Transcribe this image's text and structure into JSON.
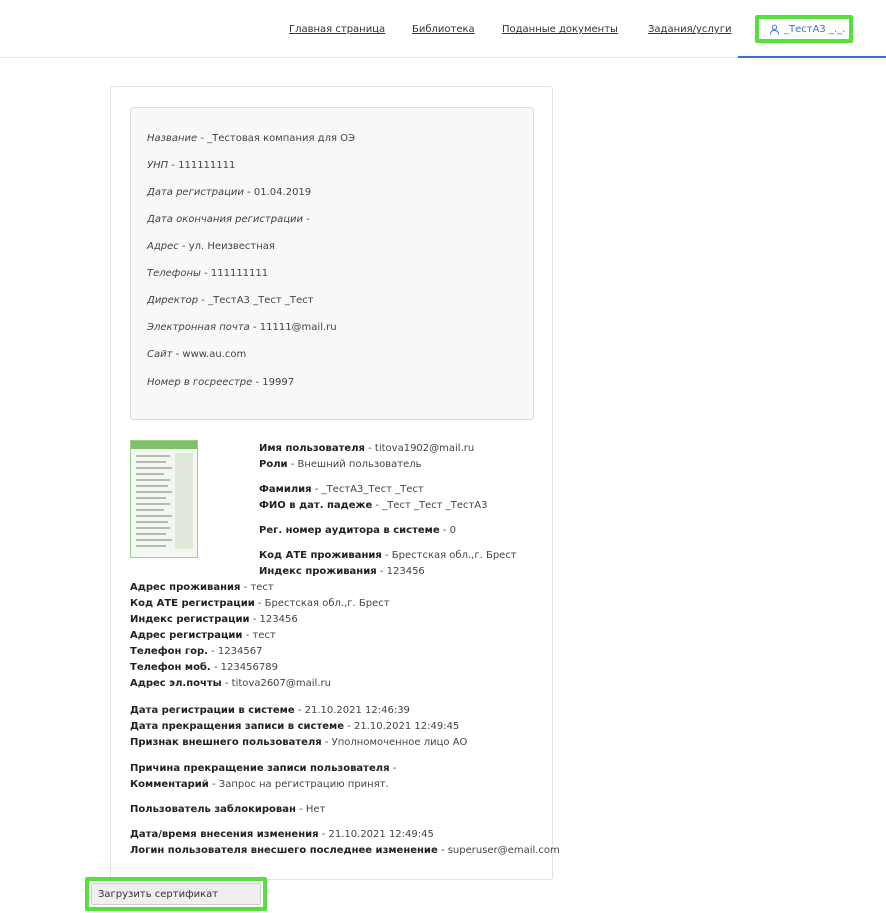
{
  "nav": {
    "items": [
      "Главная страница",
      "Библиотека",
      "Поданные документы",
      "Задания/услуги"
    ],
    "user": "_ТестА3 _._."
  },
  "company": [
    {
      "k": "Название",
      "v": " - _Тестовая компания для ОЭ"
    },
    {
      "k": "УНП",
      "v": " - 111111111"
    },
    {
      "k": "Дата регистрации",
      "v": " - 01.04.2019"
    },
    {
      "k": "Дата окончания регистрации",
      "v": " -"
    },
    {
      "k": "Адрес",
      "v": " - ул. Неизвестная"
    },
    {
      "k": "Телефоны",
      "v": " - 111111111"
    },
    {
      "k": "Директор",
      "v": " - _ТестА3 _Тест _Тест"
    },
    {
      "k": "Электронная почта",
      "v": " - 11111@mail.ru"
    },
    {
      "k": "Сайт",
      "v": " - www.au.com"
    },
    {
      "k": "Номер в госреестре",
      "v": " - 19997"
    }
  ],
  "user": [
    {
      "k": "Имя пользователя",
      "v": " - titova1902@mail.ru"
    },
    {
      "k": "Роли",
      "v": " - Внешний пользователь"
    },
    {
      "k": "Фамилия",
      "v": " - _ТестА3_Тест _Тест"
    },
    {
      "k": "ФИО в дат. падеже",
      "v": " - _Тест _Тест _ТестА3"
    },
    {
      "k": "Рег. номер аудитора в системе",
      "v": " - 0"
    },
    {
      "k": "Код АТЕ проживания",
      "v": " - Брестская обл.,г. Брест"
    },
    {
      "k": "Индекс проживания",
      "v": " - 123456"
    },
    {
      "k": "Адрес проживания",
      "v": " - тест"
    },
    {
      "k": "Код АТЕ регистрации",
      "v": " - Брестская обл.,г. Брест"
    },
    {
      "k": "Индекс регистрации",
      "v": " - 123456"
    },
    {
      "k": "Адрес регистрации",
      "v": " - тест"
    },
    {
      "k": "Телефон гор.",
      "v": " - 1234567"
    },
    {
      "k": "Телефон моб.",
      "v": " - 123456789"
    },
    {
      "k": "Адрес эл.почты",
      "v": " - titova2607@mail.ru"
    },
    {
      "k": "Дата регистрации в системе",
      "v": " - 21.10.2021 12:46:39"
    },
    {
      "k": "Дата прекращения записи в системе",
      "v": " - 21.10.2021 12:49:45"
    },
    {
      "k": "Признак внешнего пользователя",
      "v": " - Уполномоченное лицо АО"
    },
    {
      "k": "Причина прекращение записи пользователя",
      "v": " -"
    },
    {
      "k": "Комментарий",
      "v": " - Запрос на регистрацию принят."
    },
    {
      "k": "Пользователь заблокирован",
      "v": " - Нет"
    },
    {
      "k": "Дата/время внесения изменения",
      "v": " - 21.10.2021 12:49:45"
    },
    {
      "k": "Логин пользователя внесшего последнее изменение",
      "v": " - superuser@email.com"
    }
  ],
  "upload_button": "Загрузить сертификат"
}
